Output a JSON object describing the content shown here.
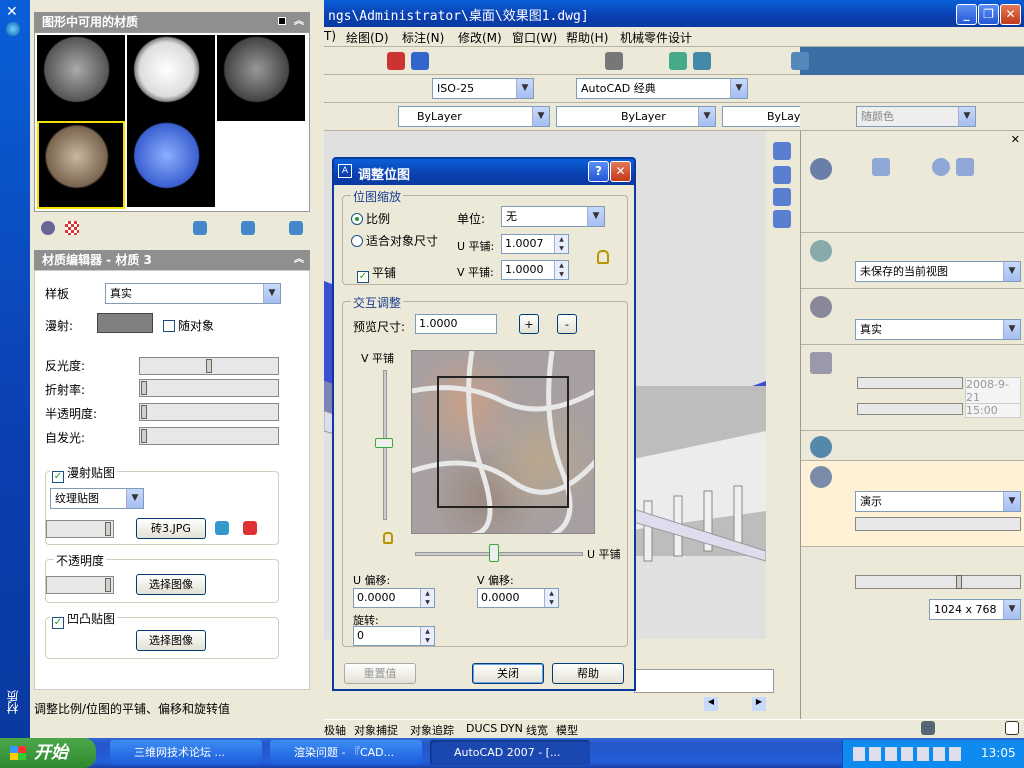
{
  "window": {
    "title": "ngs\\Administrator\\桌面\\效果图1.dwg]"
  },
  "menu": {
    "items": [
      "T)",
      "绘图(D)",
      "标注(N)",
      "修改(M)",
      "窗口(W)",
      "帮助(H)",
      "机械零件设计"
    ]
  },
  "toolbar": {
    "dimstyle": "ISO-25",
    "workspace": "AutoCAD 经典",
    "layer": "ByLayer",
    "linetype": "ByLayer",
    "lineweight": "ByLayer",
    "color": "随颜色"
  },
  "materials_panel": {
    "title": "图形中可用的材质",
    "vertical_label": "材质"
  },
  "editor": {
    "title": "材质编辑器 - 材质 3",
    "template_label": "样板",
    "template_value": "真实",
    "diffuse_label": "漫射:",
    "by_object_label": "随对象",
    "shininess_label": "反光度:",
    "refraction_label": "折射率:",
    "translucency_label": "半透明度:",
    "self_illum_label": "自发光:",
    "diffuse_map_label": "漫射贴图",
    "map_type": "纹理贴图",
    "map_file": "砖3.JPG",
    "opacity_label": "不透明度",
    "select_image_1": "选择图像",
    "bump_label": "凹凸贴图",
    "select_image_2": "选择图像",
    "status": "调整比例/位图的平铺、偏移和旋转值"
  },
  "dialog": {
    "title": "调整位图",
    "scale_group": "位图缩放",
    "ratio_label": "比例",
    "fit_label": "适合对象尺寸",
    "tile_label": "平铺",
    "unit_label": "单位:",
    "unit_value": "无",
    "u_tile_label": "U 平铺:",
    "u_tile_value": "1.0007",
    "v_tile_label": "V 平铺:",
    "v_tile_value": "1.0000",
    "interactive_group": "交互调整",
    "preview_size_label": "预览尺寸:",
    "preview_size_value": "1.0000",
    "plus": "+",
    "minus": "-",
    "v_tile_axis": "V 平铺",
    "u_tile_axis": "U 平铺",
    "u_offset_label": "U 偏移:",
    "u_offset_value": "0.0000",
    "v_offset_label": "V 偏移:",
    "v_offset_value": "0.0000",
    "rotation_label": "旋转:",
    "rotation_value": "0",
    "reset": "重置值",
    "close": "关闭",
    "help": "帮助"
  },
  "right_panel": {
    "view": "未保存的当前视图",
    "visual_style": "真实",
    "date": "2008-9-21",
    "time": "15:00",
    "render_preset": "演示",
    "resolution": "1024 x 768"
  },
  "statusbar": {
    "items": [
      "极轴",
      "对象捕捉",
      "对象追踪",
      "DUCS",
      "DYN",
      "线宽",
      "模型"
    ]
  },
  "taskbar": {
    "start": "开始",
    "tasks": [
      "三维网技术论坛 ...",
      "渲染问题 - 『CAD...",
      "AutoCAD 2007 - [..."
    ],
    "clock": "13:05"
  }
}
